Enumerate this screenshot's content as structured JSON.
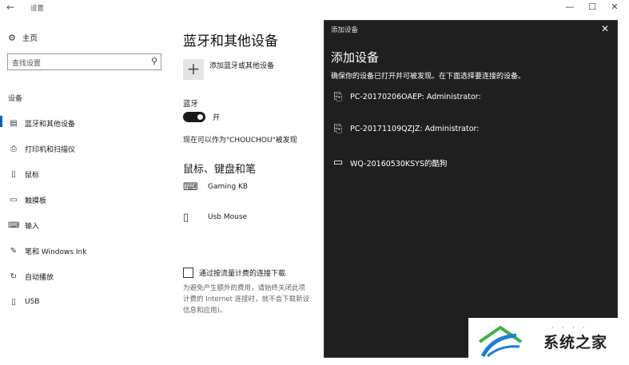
{
  "window": {
    "title": "设置",
    "back_glyph": "←",
    "minimize_glyph": "—",
    "maximize_glyph": "☐",
    "close_glyph": "✕"
  },
  "sidebar": {
    "home": {
      "icon": "gear-icon",
      "glyph": "⚙",
      "label": "主页"
    },
    "search": {
      "placeholder": "查找设置",
      "icon": "search-icon",
      "glyph": "⚲"
    },
    "section_label": "设备",
    "items": [
      {
        "label": "蓝牙和其他设备",
        "icon": "bluetooth-devices-icon",
        "glyph": "▤",
        "active": true
      },
      {
        "label": "打印机和扫描仪",
        "icon": "printer-icon",
        "glyph": "⎙",
        "active": false
      },
      {
        "label": "鼠标",
        "icon": "mouse-icon",
        "glyph": "▯",
        "active": false
      },
      {
        "label": "触摸板",
        "icon": "touchpad-icon",
        "glyph": "▭",
        "active": false
      },
      {
        "label": "输入",
        "icon": "keyboard-icon",
        "glyph": "⌨",
        "active": false
      },
      {
        "label": "笔和 Windows Ink",
        "icon": "pen-icon",
        "glyph": "✎",
        "active": false
      },
      {
        "label": "自动播放",
        "icon": "autoplay-icon",
        "glyph": "↻",
        "active": false
      },
      {
        "label": "USB",
        "icon": "usb-icon",
        "glyph": "▯",
        "active": false
      }
    ]
  },
  "main": {
    "title": "蓝牙和其他设备",
    "add_button_glyph": "+",
    "add_label": "添加蓝牙或其他设备",
    "bluetooth_label": "蓝牙",
    "bluetooth_state": "开",
    "discoverable_text": "现在可以作为\"CHOUCHOU\"被发现",
    "devices_heading": "鼠标、键盘和笔",
    "devices": [
      {
        "name": "Gaming KB",
        "icon": "keyboard-icon",
        "glyph": "⌨"
      },
      {
        "name": "Usb Mouse",
        "icon": "mouse-icon",
        "glyph": "▯"
      }
    ],
    "metered_label": "通过按流量计费的连接下载",
    "metered_desc_lines": [
      "为避免产生额外的费用，请始终关闭此项",
      "计费的 Internet 连接时，就不会下载新设",
      "信息和应用)。"
    ]
  },
  "dialog": {
    "bar_title": "添加设备",
    "close_glyph": "✕",
    "title": "添加设备",
    "description": "确保你的设备已打开并可被发现。在下面选择要连接的设备。",
    "items": [
      {
        "name": "PC-20170206OAEP: Administrator:",
        "icon": "computer-icon",
        "glyph": "⎘"
      },
      {
        "name": "PC-20171109QZJZ: Administrator:",
        "icon": "computer-icon",
        "glyph": "⎘"
      },
      {
        "name": "WQ-20160530KSYS的酷狗",
        "icon": "monitor-icon",
        "glyph": "▭"
      }
    ]
  },
  "watermark": {
    "text": "系统之家",
    "dots": "· · · ·"
  },
  "colors": {
    "accent": "#0063b1",
    "dialog_bg": "#1f1f1f",
    "toggle_on": "#1a1a1a"
  }
}
